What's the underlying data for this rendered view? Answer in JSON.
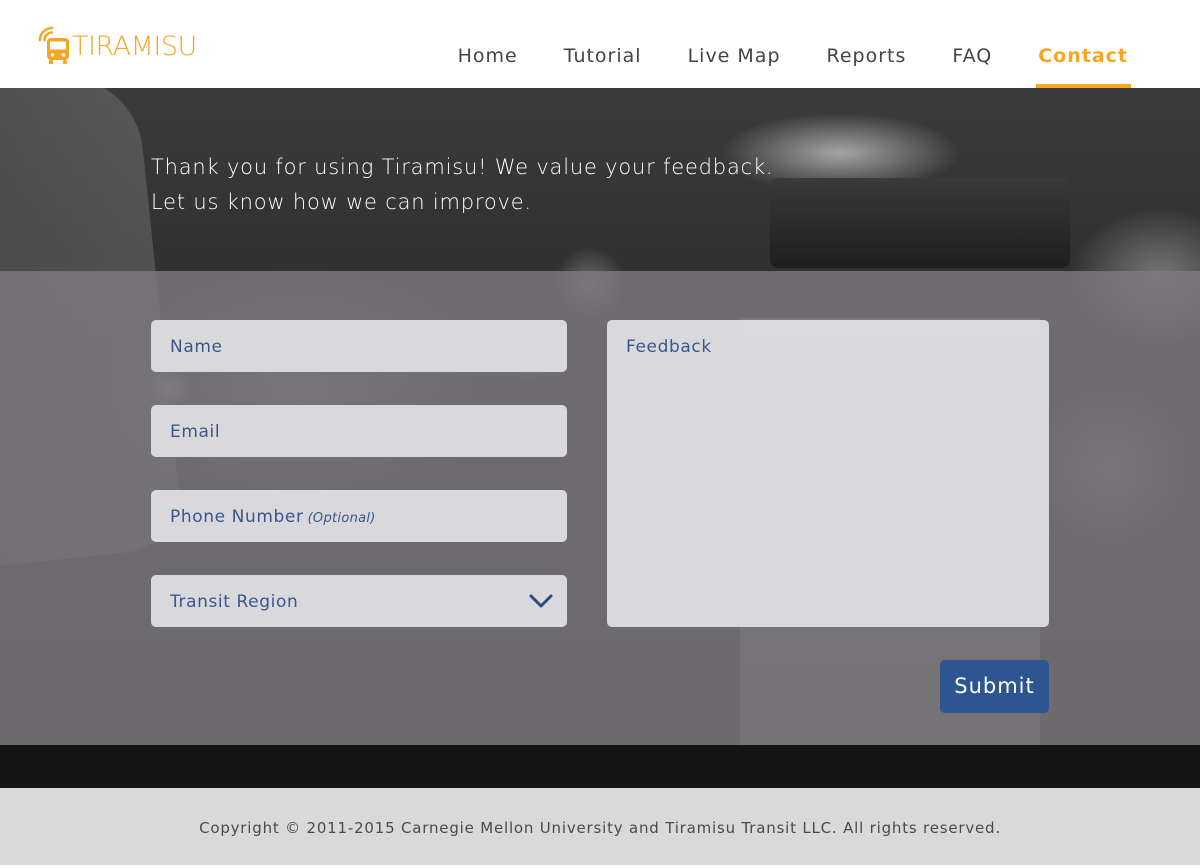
{
  "brand": {
    "logo_text": "TIRAMISU",
    "accent_color": "#f5a623"
  },
  "nav": {
    "items": [
      {
        "label": "Home",
        "active": false
      },
      {
        "label": "Tutorial",
        "active": false
      },
      {
        "label": "Live Map",
        "active": false
      },
      {
        "label": "Reports",
        "active": false
      },
      {
        "label": "FAQ",
        "active": false
      },
      {
        "label": "Contact",
        "active": true
      }
    ]
  },
  "intro": {
    "line1": "Thank you for using Tiramisu! We value your feedback.",
    "line2": "Let us know how we can improve."
  },
  "form": {
    "name_placeholder": "Name",
    "email_placeholder": "Email",
    "phone_placeholder": "Phone Number",
    "phone_optional": "(Optional)",
    "region_placeholder": "Transit Region",
    "feedback_placeholder": "Feedback",
    "submit_label": "Submit",
    "field_text_color": "#3a5789",
    "submit_color": "#2c5592"
  },
  "icons": {
    "logo": "bus-signal-icon",
    "dropdown": "chevron-down-icon"
  },
  "footer": {
    "copyright": "Copyright © 2011-2015 Carnegie Mellon University and Tiramisu Transit LLC. All rights reserved."
  }
}
